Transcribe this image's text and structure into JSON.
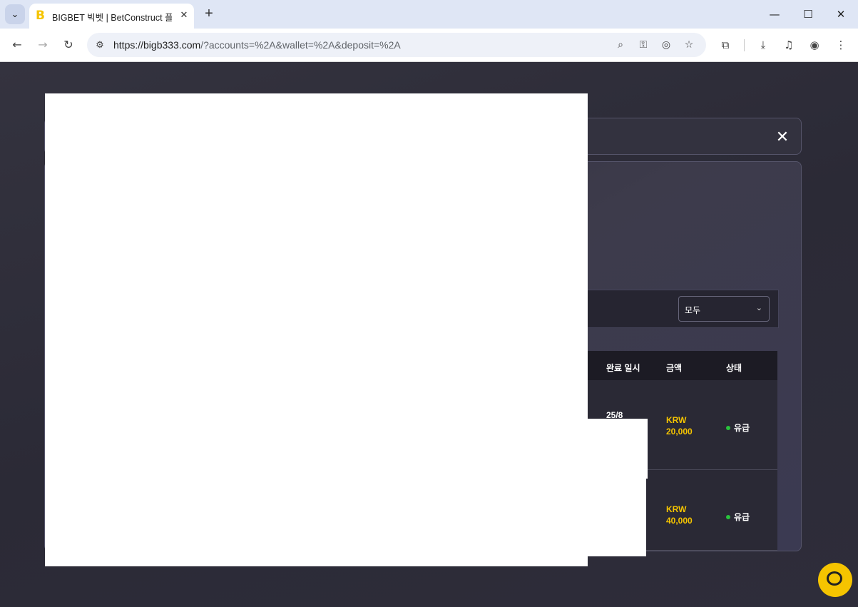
{
  "browser": {
    "tab_title": "BIGBET 빅벳 | BetConstruct 플랫폼",
    "tab_favicon": "B",
    "url_host": "https://bigb333.com",
    "url_path": "/?accounts=%2A&wallet=%2A&deposit=%2A",
    "icons": [
      "tab-menu-icon",
      "close-icon",
      "new-tab-icon",
      "minimize-icon",
      "maximize-icon",
      "window-close-icon",
      "back-icon",
      "forward-icon",
      "reload-icon",
      "site-info-icon",
      "zoom-icon",
      "password-key-icon",
      "eye-off-icon",
      "star-icon",
      "extensions-icon",
      "download-icon",
      "media-icon",
      "profile-icon",
      "menu-icon"
    ]
  },
  "modal": {
    "close_glyph": "✕",
    "filter": {
      "selected": "모두"
    },
    "table": {
      "headers": {
        "completed": "완료 일시",
        "amount": "금액",
        "status": "상태"
      },
      "rows": [
        {
          "date": "25/8",
          "amount_currency": "KRW",
          "amount_value": "20,000",
          "status": "유급"
        },
        {
          "date": "",
          "amount_currency": "KRW",
          "amount_value": "40,000",
          "status": "유급"
        }
      ]
    }
  },
  "colors": {
    "accent": "#f5c400",
    "status_paid": "#29c33c",
    "bg": "#2c2b38"
  },
  "chat": {
    "icon": "chat-bubble-icon"
  }
}
